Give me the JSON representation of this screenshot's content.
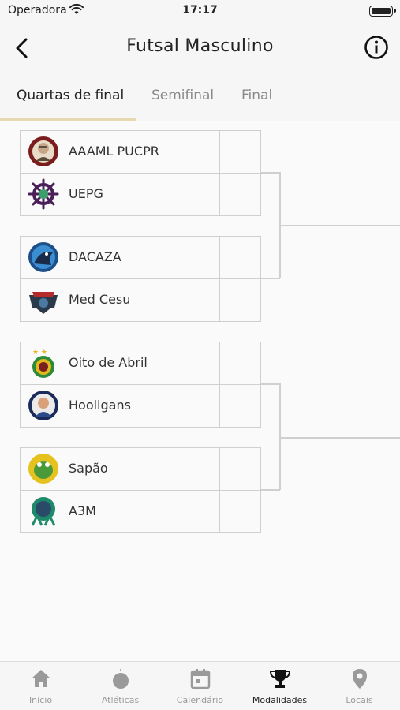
{
  "status": {
    "carrier": "Operadora",
    "time": "17:17"
  },
  "nav": {
    "title": "Futsal Masculino"
  },
  "tabs": [
    "Quartas de final",
    "Semifinal",
    "Final"
  ],
  "matches": [
    {
      "teams": [
        {
          "name": "AAAML PUCPR",
          "score": ""
        },
        {
          "name": "UEPG",
          "score": ""
        }
      ]
    },
    {
      "teams": [
        {
          "name": "DACAZA",
          "score": ""
        },
        {
          "name": "Med Cesu",
          "score": ""
        }
      ]
    },
    {
      "teams": [
        {
          "name": "Oito de Abril",
          "score": ""
        },
        {
          "name": "Hooligans",
          "score": ""
        }
      ]
    },
    {
      "teams": [
        {
          "name": "Sapão",
          "score": ""
        },
        {
          "name": "A3M",
          "score": ""
        }
      ]
    }
  ],
  "tabbar": [
    {
      "label": "Início",
      "icon": "home-icon"
    },
    {
      "label": "Atléticas",
      "icon": "medal-icon"
    },
    {
      "label": "Calendário",
      "icon": "calendar-icon"
    },
    {
      "label": "Modalidades",
      "icon": "trophy-icon"
    },
    {
      "label": "Locais",
      "icon": "location-pin-icon"
    }
  ],
  "colors": {
    "accent_underline": "#e6d9b0",
    "active": "#222222",
    "inactive": "#9a9a9a",
    "bracket_line": "#cfcfcf"
  }
}
